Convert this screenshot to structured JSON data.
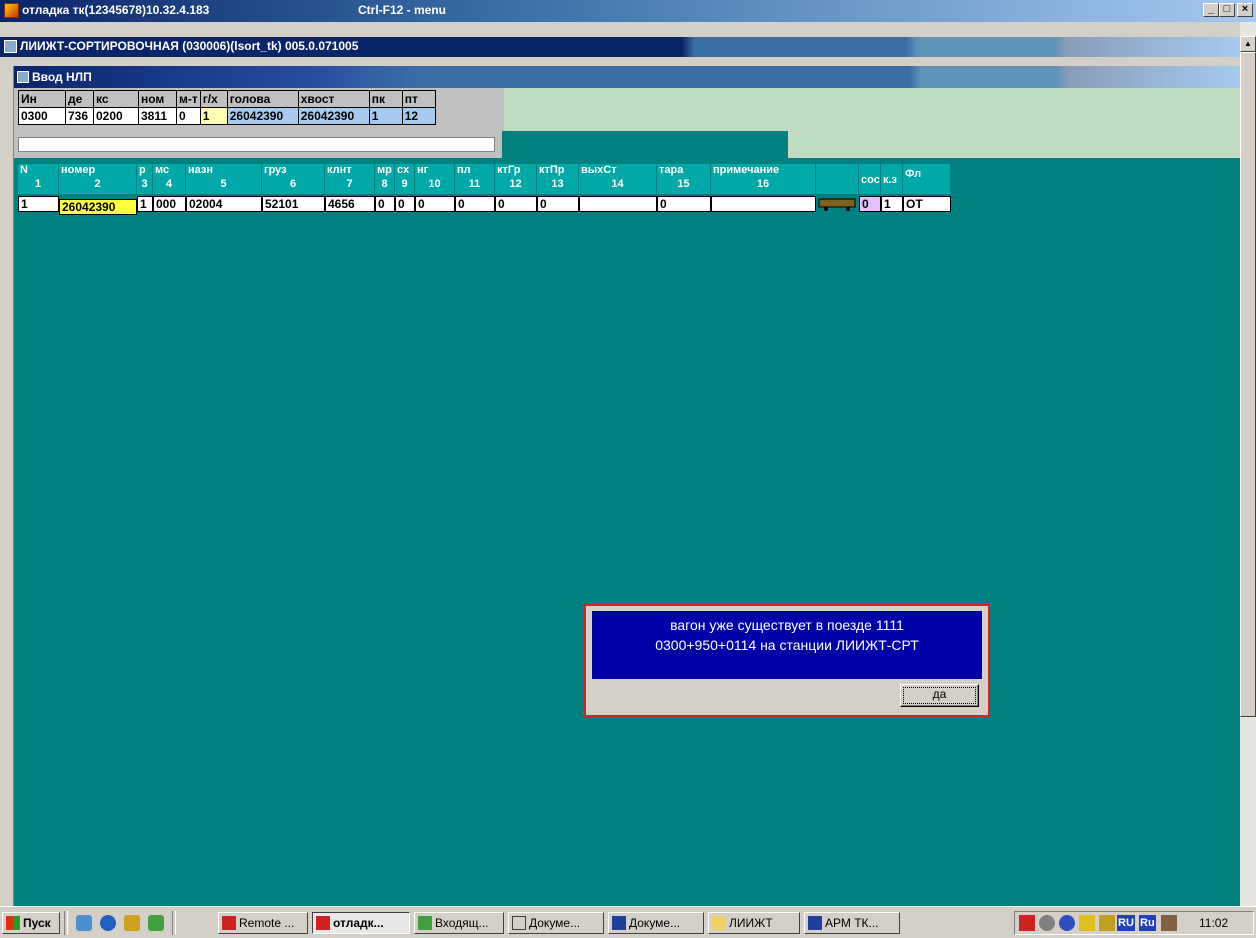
{
  "outer_window": {
    "title": "отладка тк(12345678)10.32.4.183",
    "hint": "Ctrl-F12 - menu"
  },
  "inner_window": {
    "title": "ЛИИЖТ-СОРТИРОВОЧНАЯ (030006)(lsort_tk) 005.0.071005"
  },
  "form": {
    "title": "Ввод НЛП"
  },
  "header_table": {
    "columns": [
      "Ин",
      "де",
      "кс",
      "ном",
      "м-т",
      "г/х",
      "голова",
      "хвост",
      "пк",
      "пт"
    ],
    "values": [
      "0300",
      "736",
      "0200",
      "3811",
      "0",
      "1",
      "26042390",
      "26042390",
      "1",
      "12"
    ]
  },
  "wagon_grid": {
    "columns": [
      {
        "label": "N",
        "num": "1"
      },
      {
        "label": "номер",
        "num": "2"
      },
      {
        "label": "р",
        "num": "3"
      },
      {
        "label": "мс",
        "num": "4"
      },
      {
        "label": "назн",
        "num": "5"
      },
      {
        "label": "груз",
        "num": "6"
      },
      {
        "label": "клнт",
        "num": "7"
      },
      {
        "label": "мр",
        "num": "8"
      },
      {
        "label": "сх",
        "num": "9"
      },
      {
        "label": "нг",
        "num": "10"
      },
      {
        "label": "пл",
        "num": "11"
      },
      {
        "label": "ктГр",
        "num": "12"
      },
      {
        "label": "ктПр",
        "num": "13"
      },
      {
        "label": "выхСт",
        "num": "14"
      },
      {
        "label": "тара",
        "num": "15"
      },
      {
        "label": "примечание",
        "num": "16"
      },
      {
        "label": "",
        "num": ""
      },
      {
        "label": "сос",
        "num": ""
      },
      {
        "label": "к.з",
        "num": ""
      },
      {
        "label": "Фл",
        "num": ""
      }
    ],
    "rows": [
      [
        "1",
        "26042390",
        "1",
        "000",
        "02004",
        "52101",
        "4656",
        "0",
        "0",
        "0",
        "0",
        "0",
        "0",
        "",
        "0",
        "",
        "",
        "0",
        "1",
        "ОТ"
      ]
    ]
  },
  "dialog": {
    "line1": "вагон уже существует в поезде 1111",
    "line2": "0300+950+0114  на станции ЛИИЖТ-СРТ",
    "ok_label": "да"
  },
  "taskbar": {
    "start_label": "Пуск",
    "buttons": [
      "Remote ...",
      "отладк...",
      "Входящ...",
      "Докуме...",
      "Докуме...",
      "ЛИИЖТ",
      "АРМ ТК..."
    ],
    "tray_lang1": "RU",
    "tray_lang2": "Ru",
    "clock": "11:02"
  }
}
